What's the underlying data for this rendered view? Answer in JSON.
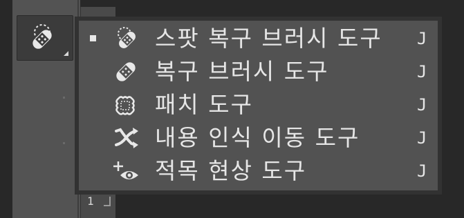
{
  "toolbar": {
    "active_tool_icon": "band-aid-spot-icon",
    "bottom_number": "1"
  },
  "flyout": {
    "items": [
      {
        "label": "스팟 복구 브러시 도구",
        "shortcut": "J",
        "icon": "spot-healing-brush-icon",
        "selected": true
      },
      {
        "label": "복구 브러시 도구",
        "shortcut": "J",
        "icon": "healing-brush-icon",
        "selected": false
      },
      {
        "label": "패치 도구",
        "shortcut": "J",
        "icon": "patch-icon",
        "selected": false
      },
      {
        "label": "내용 인식 이동 도구",
        "shortcut": "J",
        "icon": "content-aware-move-icon",
        "selected": false
      },
      {
        "label": "적목 현상 도구",
        "shortcut": "J",
        "icon": "red-eye-icon",
        "selected": false
      }
    ]
  },
  "colors": {
    "menu_bg": "#525252",
    "menu_border": "#323232",
    "text": "#e6e6e6",
    "canvas_bg": "#282828",
    "toolbar_bg": "#535353"
  }
}
